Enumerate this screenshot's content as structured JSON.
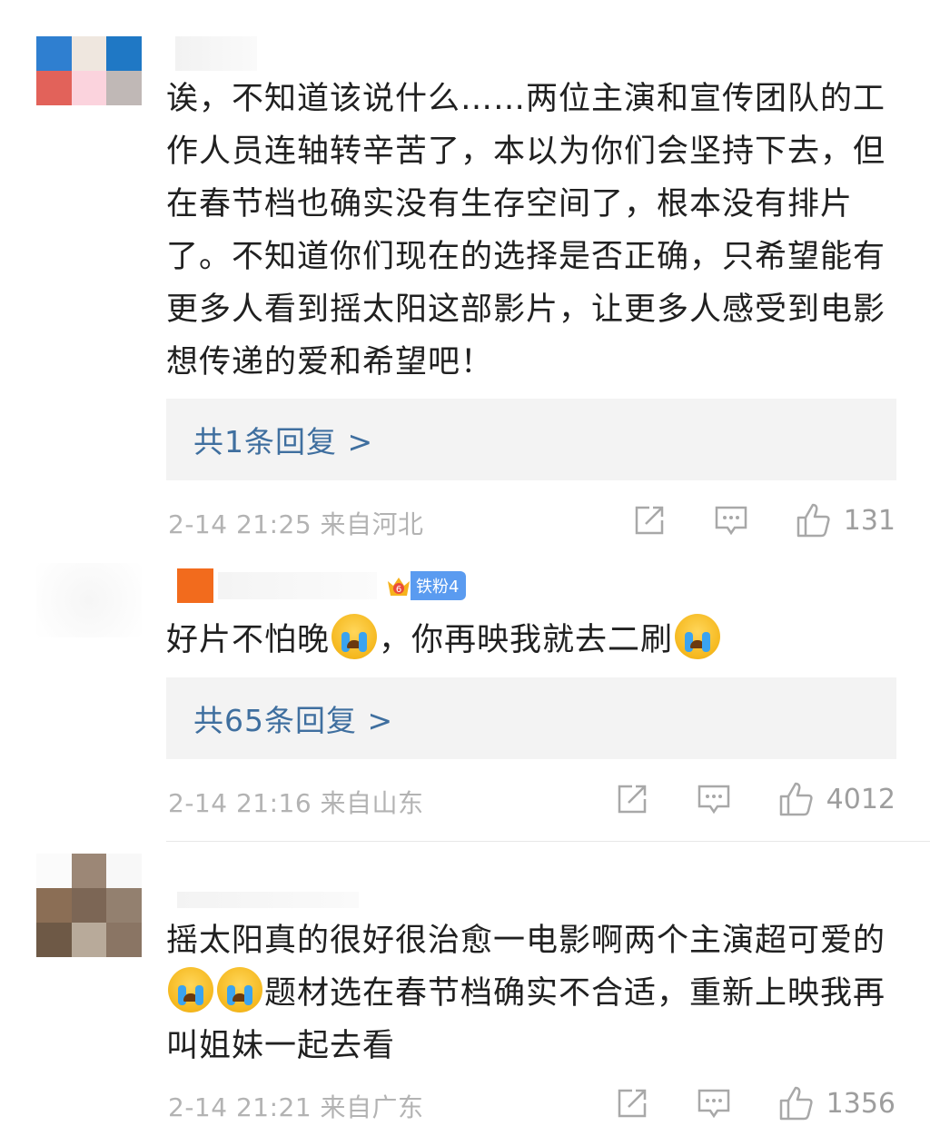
{
  "comments": [
    {
      "text": "诶，不知道该说什么……两位主演和宣传团队的工作人员连轴转辛苦了，本以为你们会坚持下去，但在春节档也确实没有生存空间了，根本没有排片了。不知道你们现在的选择是否正确，只希望能有更多人看到摇太阳这部影片，让更多人感受到电影想传递的爱和希望吧！",
      "reply_label": "共1条回复 >",
      "time": "2-14 21:25",
      "location": "来自河北",
      "likes": "131"
    },
    {
      "badge": "铁粉4",
      "badge_level": "6",
      "text_part1": "好片不怕晚",
      "text_part2": "，你再映我就去二刷",
      "emoji_name": "crying-face-icon",
      "reply_label": "共65条回复 >",
      "time": "2-14 21:16",
      "location": "来自山东",
      "likes": "4012"
    },
    {
      "text_part1": "摇太阳真的很好很治愈一电影啊两个主演超可爱的",
      "text_part2": "题材选在春节档确实不合适，重新上映我再叫姐妹一起去看",
      "emoji_name": "crying-face-icon",
      "time": "2-14 21:21",
      "location": "来自广东",
      "likes": "1356"
    }
  ],
  "colors": {
    "link": "#3f6f9f",
    "meta": "#b3b3b3",
    "reply_bg": "#f3f3f3",
    "badge": "#5a9bf0"
  }
}
